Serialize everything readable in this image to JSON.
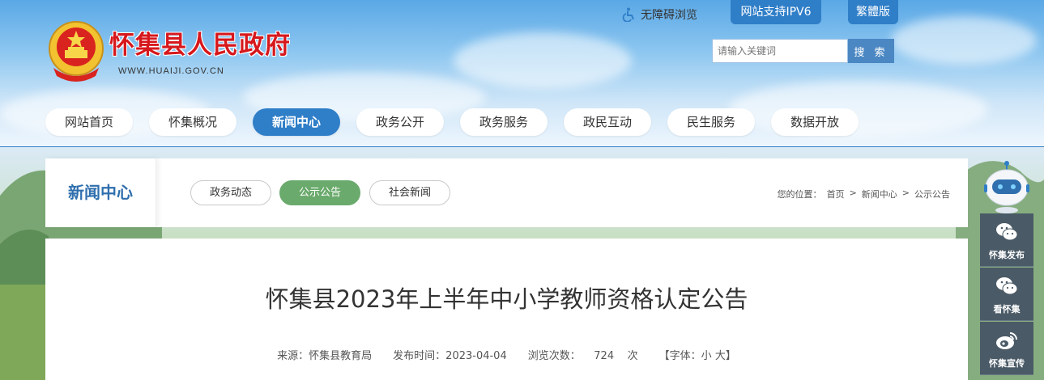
{
  "header": {
    "site_title": "怀集县人民政府",
    "site_url": "WWW.HUAIJI.GOV.CN",
    "accessibility_label": "无障碍浏览",
    "ipv6_label": "网站支持IPV6",
    "traditional_label": "繁體版",
    "search_placeholder": "请输入关键词",
    "search_button": "搜 索"
  },
  "nav": {
    "items": [
      {
        "label": "网站首页"
      },
      {
        "label": "怀集概况"
      },
      {
        "label": "新闻中心"
      },
      {
        "label": "政务公开"
      },
      {
        "label": "政务服务"
      },
      {
        "label": "政民互动"
      },
      {
        "label": "民生服务"
      },
      {
        "label": "数据开放"
      }
    ],
    "active": "新闻中心"
  },
  "section": {
    "title": "新闻中心",
    "tabs": [
      {
        "label": "政务动态"
      },
      {
        "label": "公示公告"
      },
      {
        "label": "社会新闻"
      }
    ],
    "active_tab": "公示公告",
    "breadcrumb": {
      "prefix": "您的位置：",
      "items": [
        "首页",
        "新闻中心",
        "公示公告"
      ],
      "separator": ">"
    }
  },
  "article": {
    "title": "怀集县2023年上半年中小学教师资格认定公告",
    "source_label": "来源：",
    "source": "怀集县教育局",
    "date_label": "发布时间：",
    "date": "2023-04-04",
    "views_label": "浏览次数：",
    "views": "724",
    "views_unit": "次",
    "font_label": "【字体：",
    "font_small": "小",
    "font_large": "大",
    "font_close": "】"
  },
  "sidebar": {
    "items": [
      {
        "label": "怀集发布",
        "icon": "wechat-icon"
      },
      {
        "label": "看怀集",
        "icon": "wechat-icon"
      },
      {
        "label": "怀集宣传",
        "icon": "weibo-icon"
      }
    ]
  },
  "colors": {
    "primary": "#2f7ec8",
    "accent_red": "#d6181d",
    "active_tab": "#6aaa6c",
    "sidebar_bg": "#4a5a66"
  }
}
